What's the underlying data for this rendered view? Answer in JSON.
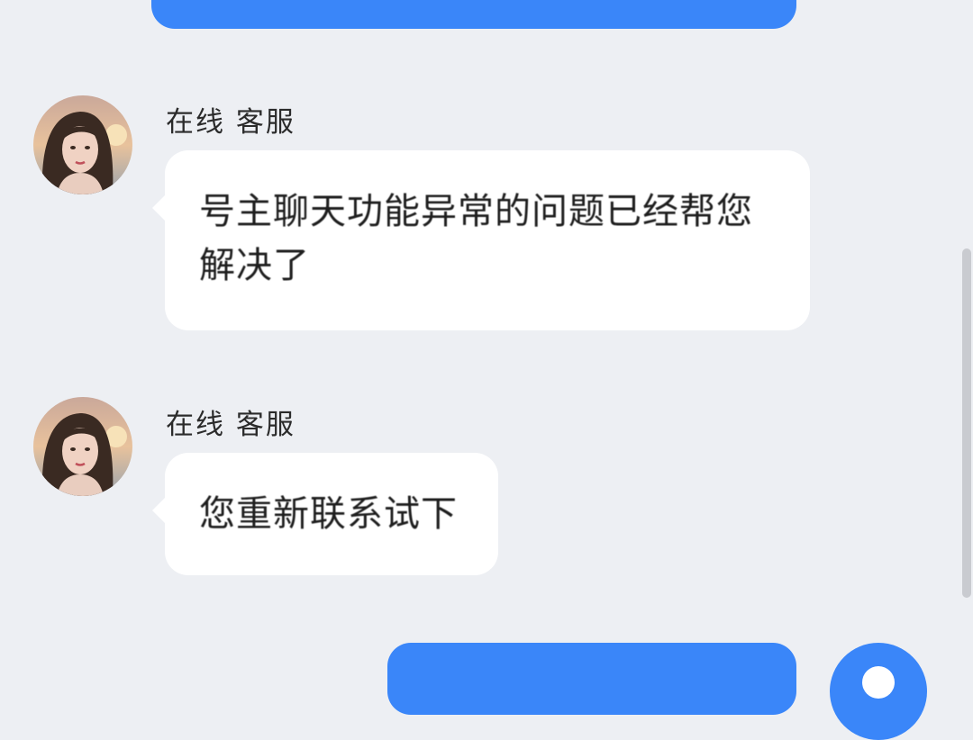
{
  "messages": [
    {
      "sender": "在线 客服",
      "text": "号主聊天功能异常的问题已经帮您解决了"
    },
    {
      "sender": "在线 客服",
      "text": "您重新联系试下"
    }
  ],
  "colors": {
    "background": "#EDEFF3",
    "outgoing_bubble": "#3A86F9",
    "incoming_bubble": "#FFFFFF",
    "scrollbar": "#C9CBD0"
  }
}
